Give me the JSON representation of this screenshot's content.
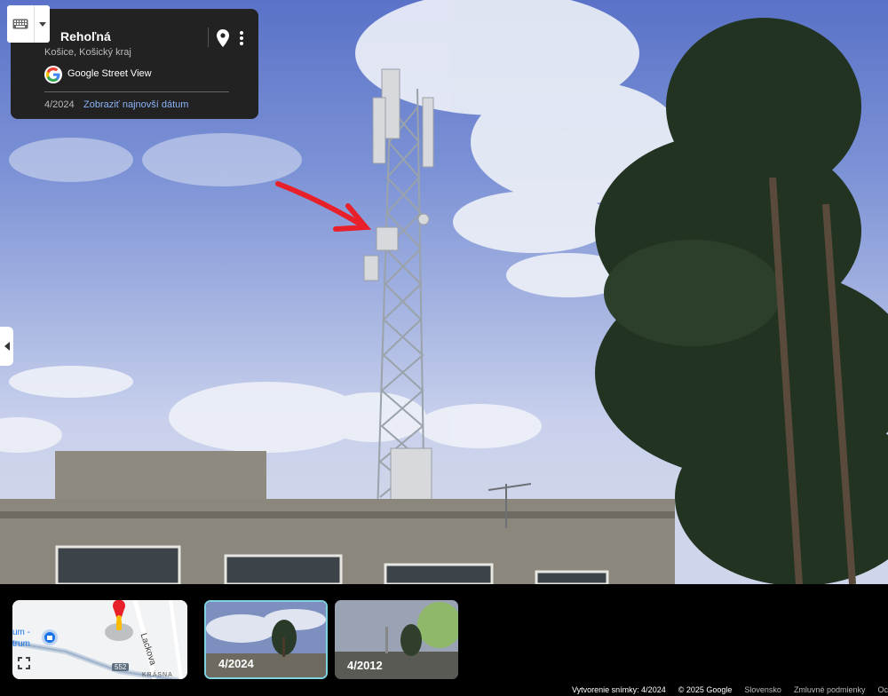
{
  "info_card": {
    "title": "Rehoľná",
    "subtitle": "Košice, Košický kraj",
    "brand": "Google Street View",
    "current_date": "4/2024",
    "latest_link": "Zobraziť najnovší dátum"
  },
  "minimap": {
    "street_label": "Lackova",
    "road_number": "552",
    "street_label_2": "KRÁSNA",
    "poi_label": "um -\ntrum"
  },
  "thumbnails": [
    {
      "label": "4/2024",
      "selected": true
    },
    {
      "label": "4/2012",
      "selected": false
    }
  ],
  "footer": {
    "capture": "Vytvorenie snímky: 4/2024",
    "copyright": "© 2025 Google",
    "country": "Slovensko",
    "terms": "Zmluvné podmienky",
    "more": "Oc"
  },
  "colors": {
    "sky": "#7d93d6",
    "arrow": "#e8202a",
    "link": "#8ab4f8",
    "selected_border": "#7fd3e0"
  }
}
